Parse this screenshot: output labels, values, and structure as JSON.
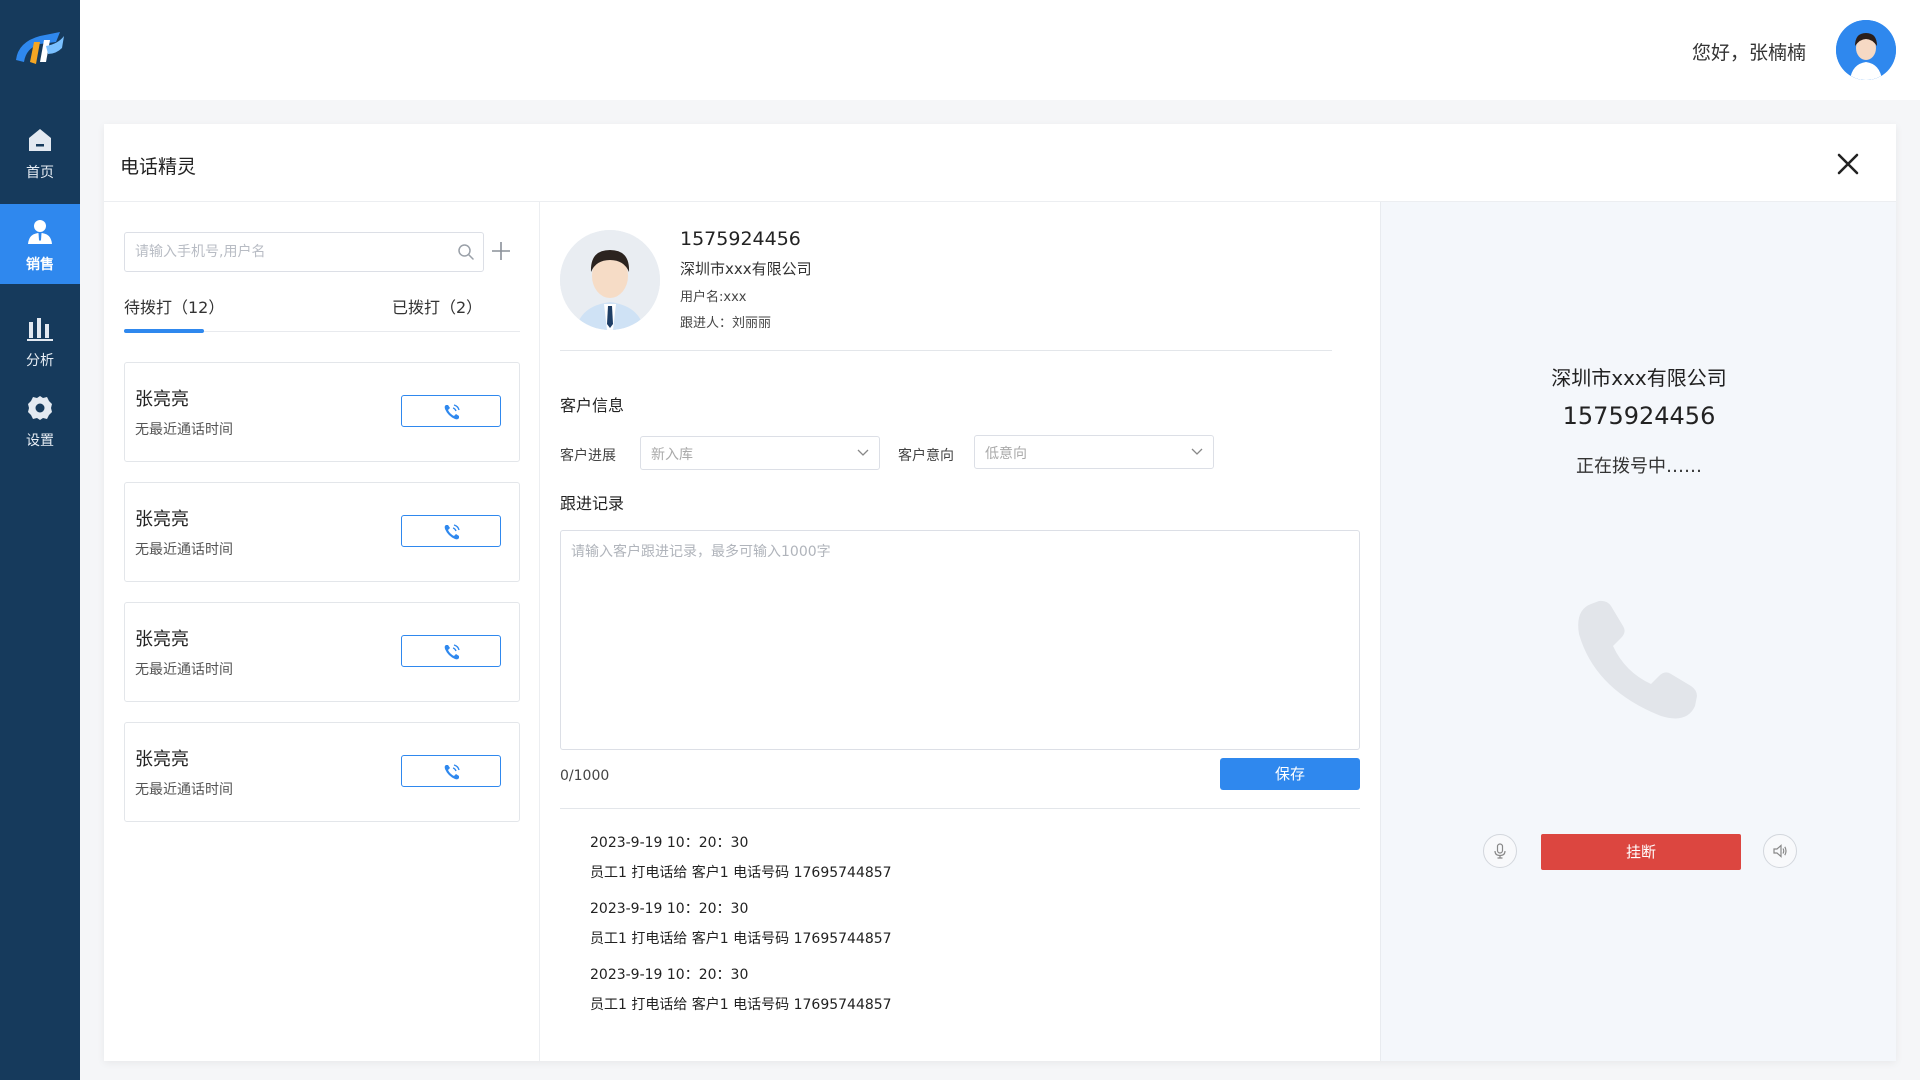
{
  "nav": {
    "items": [
      {
        "label": "首页",
        "icon": "home-icon"
      },
      {
        "label": "销售",
        "icon": "user-icon",
        "active": true
      },
      {
        "label": "分析",
        "icon": "bar-chart-icon"
      },
      {
        "label": "设置",
        "icon": "gear-icon"
      }
    ]
  },
  "header": {
    "greeting": "您好，张楠楠"
  },
  "modal": {
    "title": "电话精灵"
  },
  "left": {
    "search_placeholder": "请输入手机号,用户名",
    "tabs": [
      {
        "label": "待拨打（12）",
        "active": true
      },
      {
        "label": "已拨打（2）"
      }
    ],
    "contacts": [
      {
        "name": "张亮亮",
        "sub": "无最近通话时间"
      },
      {
        "name": "张亮亮",
        "sub": "无最近通话时间"
      },
      {
        "name": "张亮亮",
        "sub": "无最近通话时间"
      },
      {
        "name": "张亮亮",
        "sub": "无最近通话时间"
      }
    ]
  },
  "customer": {
    "phone": "1575924456",
    "company": "深圳市xxx有限公司",
    "username": "用户名:xxx",
    "follower": "跟进人：刘丽丽"
  },
  "info": {
    "section_title": "客户信息",
    "progress_label": "客户进展",
    "progress_value": "新入库",
    "intent_label": "客户意向",
    "intent_value": "低意向"
  },
  "followup": {
    "section_title": "跟进记录",
    "placeholder": "请输入客户跟进记录，最多可输入1000字",
    "char_count": "0/1000",
    "save_label": "保存"
  },
  "records": [
    {
      "time": "2023-9-19 10：20：30",
      "detail": "员工1  打电话给  客户1 电话号码    17695744857"
    },
    {
      "time": "2023-9-19 10：20：30",
      "detail": "员工1  打电话给  客户1 电话号码    17695744857"
    },
    {
      "time": "2023-9-19 10：20：30",
      "detail": "员工1  打电话给  客户1 电话号码    17695744857"
    }
  ],
  "call": {
    "company": "深圳市xxx有限公司",
    "number": "1575924456",
    "status": "正在拨号中……",
    "hangup_label": "挂断"
  },
  "colors": {
    "sidebar": "#163a5c",
    "accent": "#2f88ee",
    "hangup": "#dc4640"
  }
}
